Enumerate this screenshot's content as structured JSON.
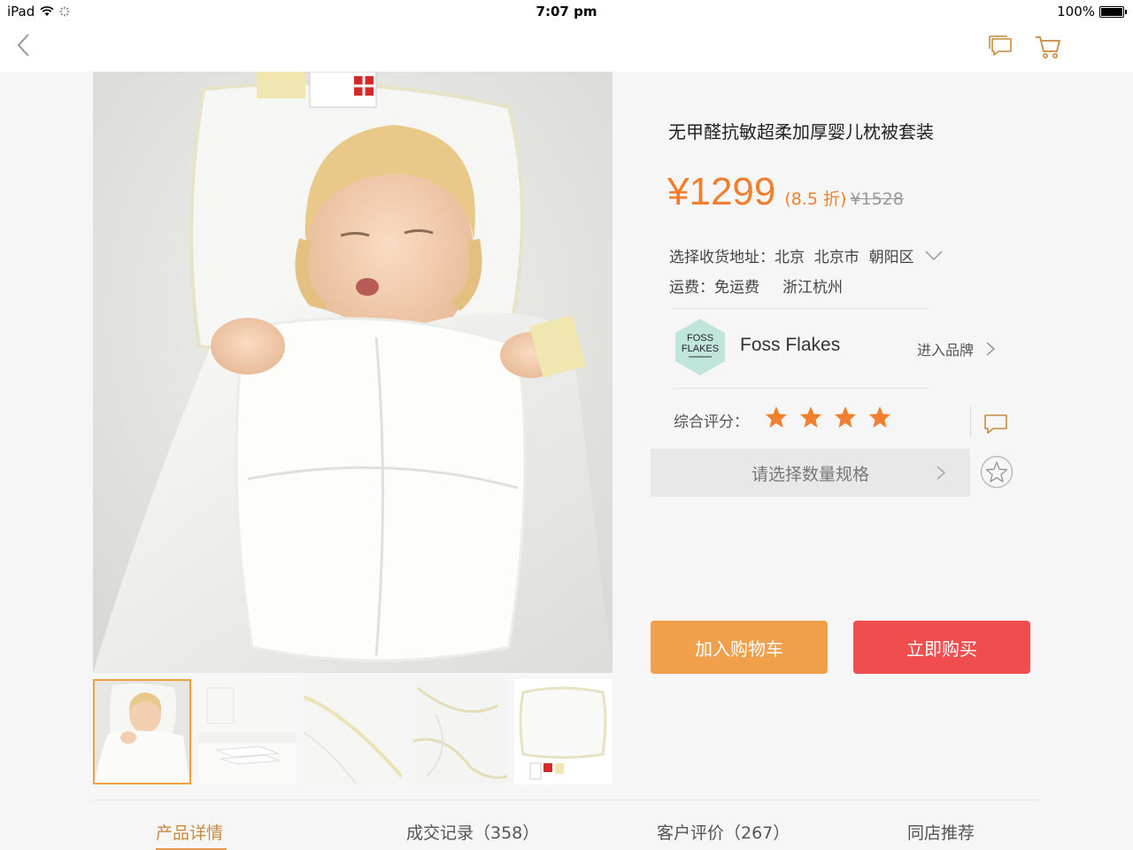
{
  "status_bar": {
    "device": "iPad",
    "time": "7:07 pm",
    "battery": "100%"
  },
  "product": {
    "title": "无甲醛抗敏超柔加厚婴儿枕被套装",
    "price": "¥1299",
    "discount": "(8.5 折)",
    "original_price": "¥1528"
  },
  "address": {
    "label": "选择收货地址：",
    "value": "北京  北京市  朝阳区"
  },
  "shipping": {
    "label": "运费：",
    "value": "免运费",
    "origin": "浙江杭州"
  },
  "brand": {
    "name": "Foss Flakes",
    "link_label": "进入品牌",
    "logo_icon": "foss-flakes-logo"
  },
  "rating": {
    "label": "综合评分：",
    "stars": 4,
    "star_color": "#f08030"
  },
  "spec_select": {
    "label": "请选择数量规格"
  },
  "buttons": {
    "add_to_cart": "加入购物车",
    "buy_now": "立即购买"
  },
  "thumbnails": {
    "count": 5,
    "selected_index": 0
  },
  "tabs": [
    {
      "label": "产品详情",
      "active": true
    },
    {
      "label": "成交记录（358）",
      "active": false
    },
    {
      "label": "客户评价（267）",
      "active": false
    },
    {
      "label": "同店推荐",
      "active": false
    }
  ],
  "colors": {
    "accent": "#f08030",
    "cart_button": "#f0a04b",
    "buy_button": "#f04e4e",
    "active_tab": "#c98a3d"
  }
}
